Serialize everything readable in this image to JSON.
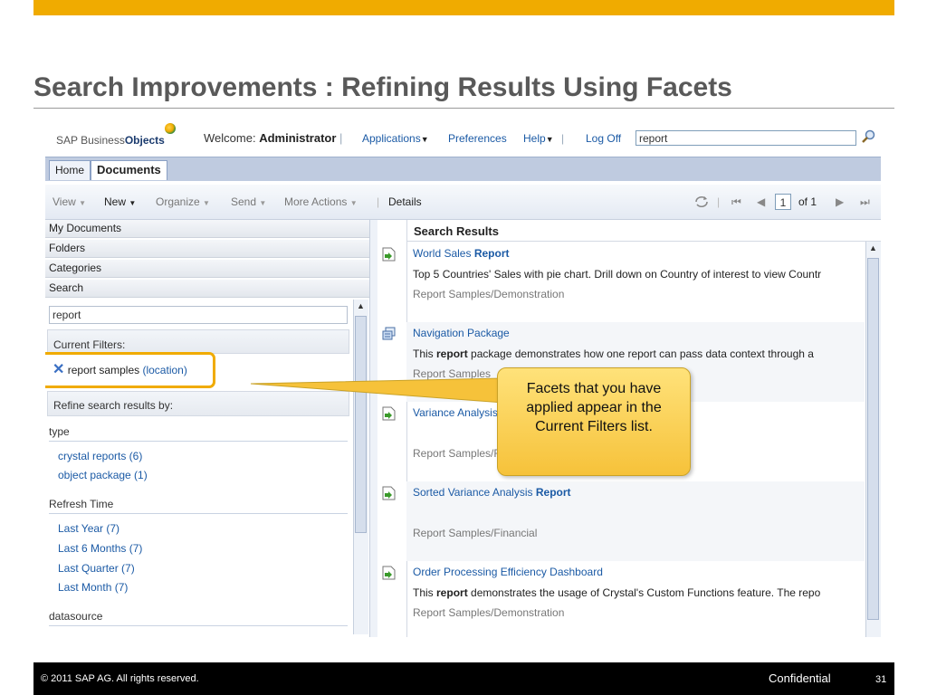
{
  "slide": {
    "title": "Search Improvements : Refining Results Using Facets",
    "copyright": "2011 SAP AG. All rights reserved.",
    "confidential": "Confidential",
    "page_number": "31"
  },
  "header": {
    "logo_text_prefix": "SAP Business",
    "logo_text_suffix": "Objects",
    "welcome_label": "Welcome:",
    "user": "Administrator",
    "applications": "Applications",
    "preferences": "Preferences",
    "help": "Help",
    "logoff": "Log Off",
    "search_value": "report"
  },
  "tabs": [
    {
      "label": "Home"
    },
    {
      "label": "Documents"
    }
  ],
  "toolbar": {
    "view": "View",
    "new": "New",
    "organize": "Organize",
    "send": "Send",
    "more_actions": "More Actions",
    "details": "Details",
    "page": "1",
    "of_pages": "of 1"
  },
  "left_panel": {
    "sections": [
      "My Documents",
      "Folders",
      "Categories",
      "Search"
    ],
    "search_value": "report",
    "current_filters_label": "Current Filters:",
    "filter": {
      "name": "report samples",
      "type": "(location)"
    },
    "refine_label": "Refine search results by:",
    "facet_groups": [
      {
        "name": "type",
        "items": [
          "crystal reports (6)",
          "object package (1)"
        ]
      },
      {
        "name": "Refresh Time",
        "items": [
          "Last Year (7)",
          "Last 6 Months (7)",
          "Last Quarter (7)",
          "Last Month (7)"
        ]
      },
      {
        "name": "datasource",
        "items": []
      }
    ]
  },
  "results": {
    "heading": "Search Results",
    "items": [
      {
        "title_pre": "World Sales ",
        "title_bold": "Report",
        "desc_pre": "Top 5 Countries' Sales with pie chart. Drill down on Country of interest to view Countr",
        "desc_bold": "",
        "desc_post": "",
        "path": "Report Samples/Demonstration"
      },
      {
        "title_pre": "Navigation Package",
        "title_bold": "",
        "desc_pre": "This ",
        "desc_bold": "report",
        "desc_post": " package demonstrates how one report can pass data context through a",
        "path": "Report Samples"
      },
      {
        "title_pre": "Variance Analysis",
        "title_bold": "",
        "desc_pre": "",
        "desc_bold": "",
        "desc_post": "",
        "path": "Report Samples/Fi"
      },
      {
        "title_pre": "Sorted Variance Analysis ",
        "title_bold": "Report",
        "desc_pre": "",
        "desc_bold": "",
        "desc_post": "",
        "path": "Report Samples/Financial"
      },
      {
        "title_pre": "Order Processing Efficiency Dashboard",
        "title_bold": "",
        "desc_pre": "This ",
        "desc_bold": "report",
        "desc_post": " demonstrates the usage of Crystal's Custom Functions feature. The repo",
        "path": "Report Samples/Demonstration"
      }
    ]
  },
  "callout": {
    "text": "Facets that you have applied appear in the Current Filters list."
  },
  "colors": {
    "accent": "#f0ab00",
    "link": "#1b5aa5"
  }
}
